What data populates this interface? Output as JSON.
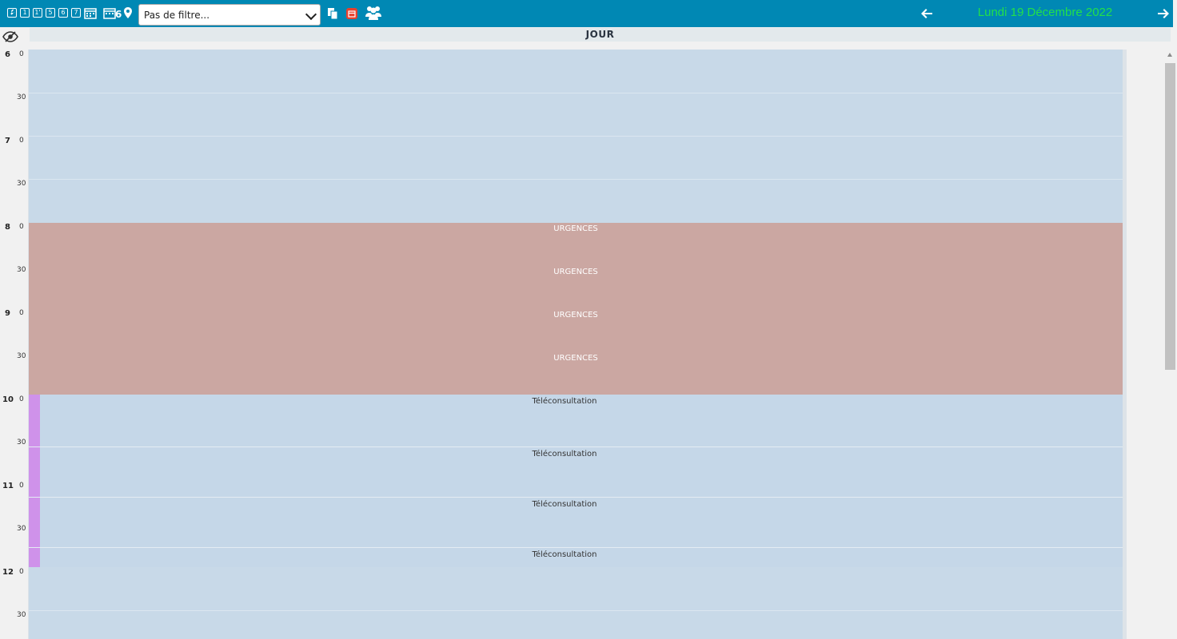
{
  "toolbar": {
    "icons": [
      "wrench-icon",
      "day-1-icon",
      "day-1-prime-icon",
      "day-5-icon",
      "day-6-icon",
      "day-7-icon",
      "calendar-grid-icon",
      "multi-calendar-icon",
      "map-pin-icon",
      "copy-icon",
      "calendar-red-icon",
      "users-icon"
    ],
    "day_buttons": [
      "1",
      "1'",
      "5",
      "6",
      "7"
    ],
    "multi_calendar_count": "6",
    "filter": {
      "selected": "Pas de filtre..."
    },
    "date_title": "Lundi 19 Décembre 2022",
    "colors": {
      "bar": "#0088b4",
      "date": "#22e04a"
    }
  },
  "agenda": {
    "column_header": "JOUR",
    "hours": [
      "6",
      "7",
      "8",
      "9",
      "10",
      "11",
      "12"
    ],
    "minute_labels": [
      "0",
      "30"
    ],
    "urgences": {
      "label": "URGENCES",
      "color": "#cba7a2",
      "labels": [
        "URGENCES",
        "URGENCES",
        "URGENCES",
        "URGENCES"
      ]
    },
    "teleconsultation": {
      "label": "Téléconsultation",
      "color": "#cf92ea",
      "labels": [
        "Téléconsultation",
        "Téléconsultation",
        "Téléconsultation",
        "Téléconsultation"
      ]
    },
    "free_slot_color": "#c8d9e8"
  }
}
